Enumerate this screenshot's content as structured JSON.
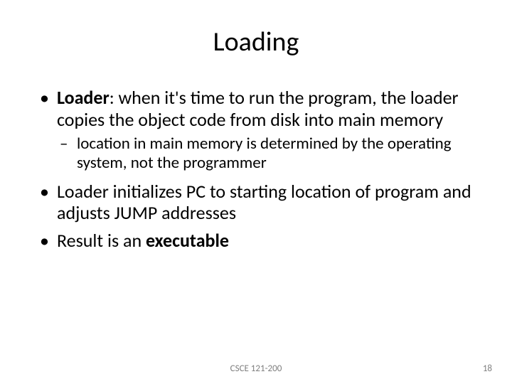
{
  "slide": {
    "title": "Loading",
    "bullets": [
      {
        "prefix_bold": "Loader",
        "rest": ": when it's time to run the program, the loader copies the object code from disk into main memory",
        "sub": [
          "location in main memory is determined by the operating system, not the programmer"
        ]
      },
      {
        "text": "Loader initializes PC to starting location of program and adjusts JUMP addresses"
      },
      {
        "prefix": "Result is an ",
        "suffix_bold": "executable"
      }
    ]
  },
  "footer": {
    "course": "CSCE 121-200",
    "page": "18"
  }
}
